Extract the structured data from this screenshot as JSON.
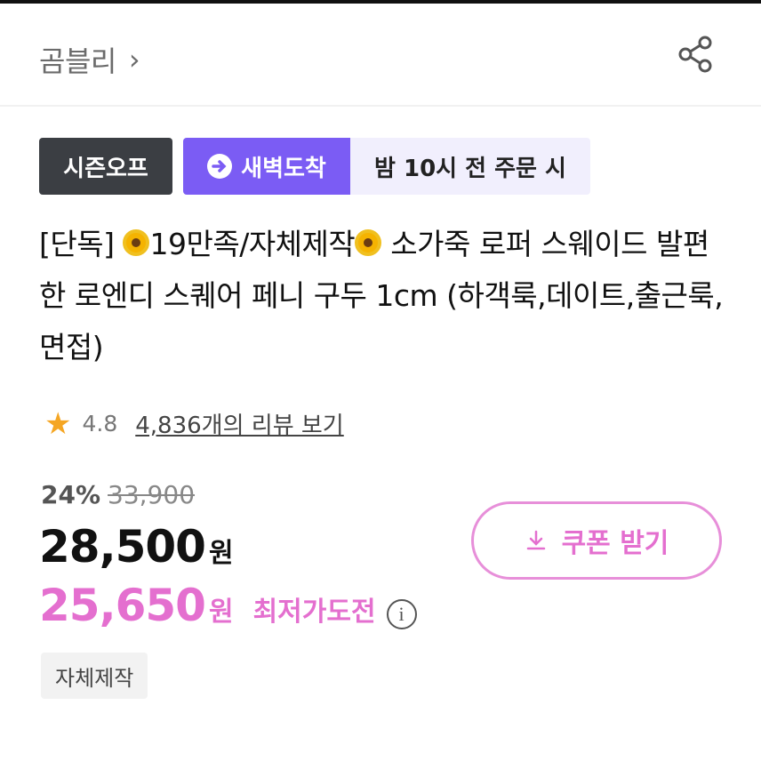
{
  "header": {
    "brand_name": "곰블리",
    "chevron": "chevron-right-icon",
    "share_icon": "share-icon"
  },
  "badges": {
    "season": "시즌오프",
    "dawn": "새벽도착",
    "order_time": "밤 10시 전 주문 시"
  },
  "product": {
    "title_prefix": "[단독]",
    "title_mid": "19만족/자체제작",
    "title_rest": "소가죽 로퍼 스웨이드 발편한 로엔디 스퀘어 페니 구두 1cm (하객룩,데이트,출근룩,면접)"
  },
  "rating": {
    "score": "4.8",
    "review_link": "4,836개의 리뷰 보기"
  },
  "price": {
    "discount_rate": "24%",
    "original_price": "33,900",
    "sale_price": "28,500",
    "currency": "원",
    "best_price": "25,650",
    "best_label": "최저가도전",
    "info_icon": "i"
  },
  "coupon": {
    "label": "쿠폰 받기"
  },
  "tag": {
    "label": "자체제작"
  },
  "colors": {
    "accent_pink": "#e46fcf",
    "purple": "#7b5cf4",
    "dark_badge": "#3b3e43",
    "star": "#f5a623"
  }
}
